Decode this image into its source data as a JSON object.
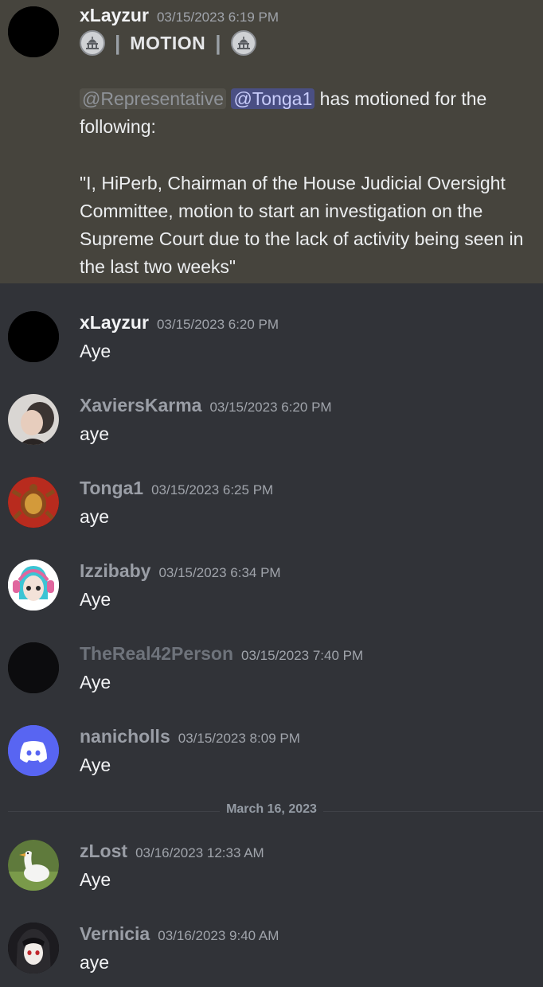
{
  "messages": [
    {
      "username": "xLayzur",
      "username_color": "#f2f3f5",
      "timestamp": "03/15/2023 6:19 PM",
      "motion_label": "MOTION",
      "role_mention": "@Representative",
      "user_mention": "@Tonga1",
      "intro_text": " has motioned for the following:",
      "quote_text": "\"I, HiPerb, Chairman of the House Judicial Oversight Committee, motion to start an investigation on the Supreme Court due to the lack of activity being seen in the last two weeks\""
    },
    {
      "username": "xLayzur",
      "username_color": "#f2f3f5",
      "timestamp": "03/15/2023 6:20 PM",
      "text": "Aye"
    },
    {
      "username": "XaviersKarma",
      "username_color": "#9a9ea6",
      "timestamp": "03/15/2023 6:20 PM",
      "text": "aye"
    },
    {
      "username": "Tonga1",
      "username_color": "#9a9ea6",
      "timestamp": "03/15/2023 6:25 PM",
      "text": "aye"
    },
    {
      "username": "Izzibaby",
      "username_color": "#9a9ea6",
      "timestamp": "03/15/2023 6:34 PM",
      "text": "Aye"
    },
    {
      "username": "TheReal42Person",
      "username_color": "#6e737b",
      "timestamp": "03/15/2023 7:40 PM",
      "text": "Aye"
    },
    {
      "username": "nanicholls",
      "username_color": "#9a9ea6",
      "timestamp": "03/15/2023 8:09 PM",
      "text": "Aye"
    },
    {
      "username": "zLost",
      "username_color": "#9a9ea6",
      "timestamp": "03/16/2023 12:33 AM",
      "text": "Aye"
    },
    {
      "username": "Vernicia",
      "username_color": "#9a9ea6",
      "timestamp": "03/16/2023 9:40 AM",
      "text": "aye"
    }
  ],
  "date_divider": "March 16, 2023",
  "colors": {
    "background": "#313338",
    "highlight": "#46443d",
    "discord_blurple": "#5865f2",
    "mention_user_bg": "#4a4f83"
  }
}
